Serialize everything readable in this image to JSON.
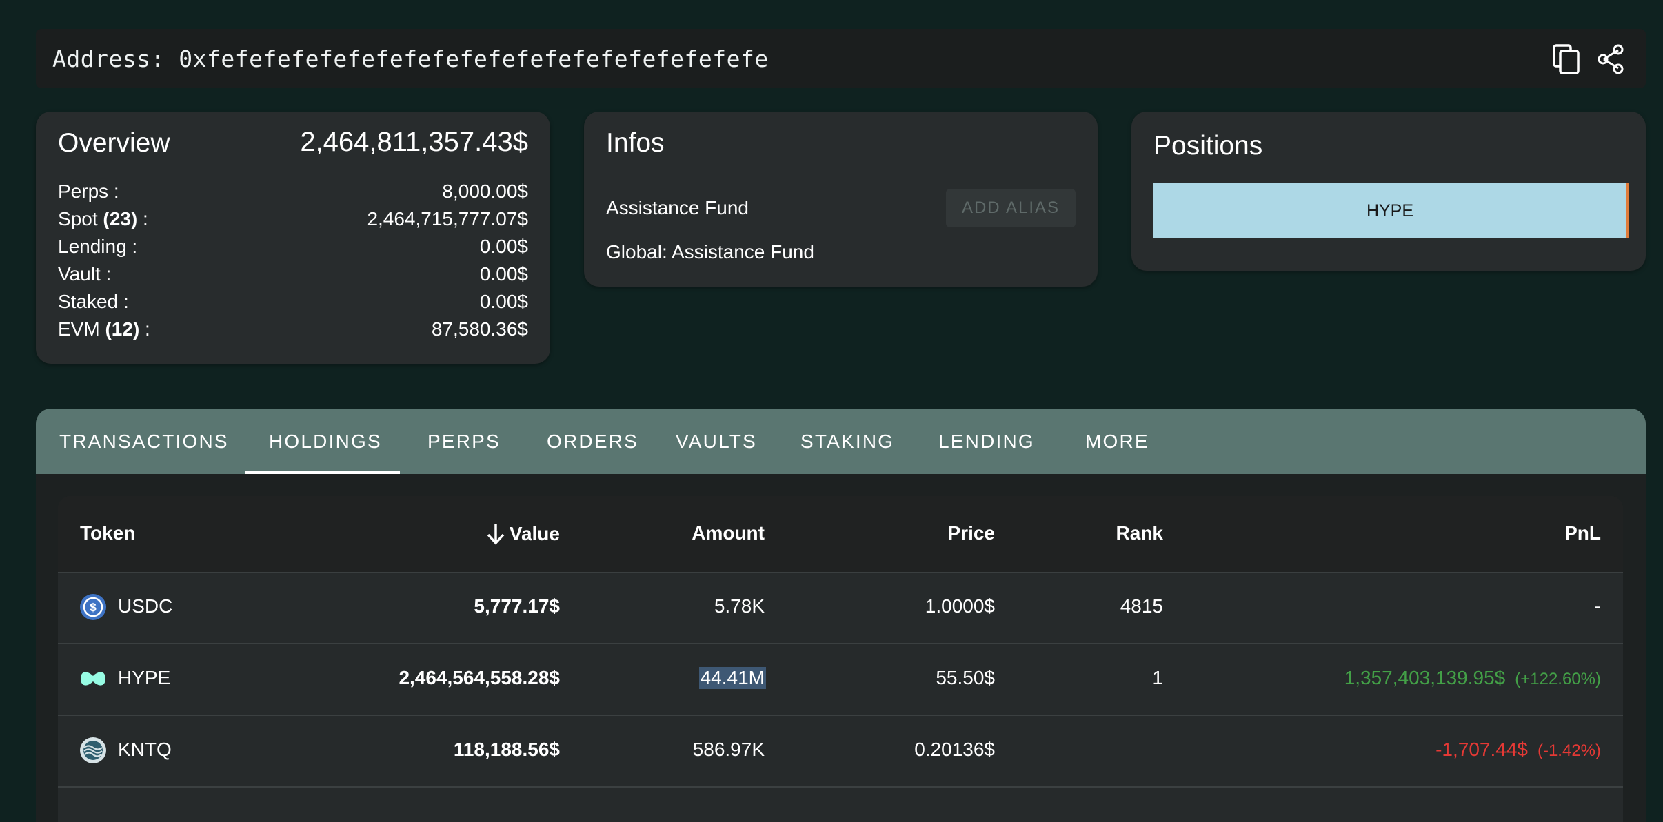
{
  "address": {
    "label": "Address: 0xfefefefefefefefefefefefefefefefefefefefe"
  },
  "overview": {
    "title": "Overview",
    "total": "2,464,811,357.43$",
    "rows": [
      {
        "label": "Perps :",
        "value": "8,000.00$"
      },
      {
        "label_prefix": "Spot ",
        "count": "(23)",
        "label_suffix": " :",
        "value": "2,464,715,777.07$"
      },
      {
        "label": "Lending :",
        "value": "0.00$"
      },
      {
        "label": "Vault :",
        "value": "0.00$"
      },
      {
        "label": "Staked :",
        "value": "0.00$"
      },
      {
        "label_prefix": "EVM ",
        "count": "(12)",
        "label_suffix": " :",
        "value": "87,580.36$"
      }
    ]
  },
  "infos": {
    "title": "Infos",
    "name": "Assistance Fund",
    "global": "Global: Assistance Fund",
    "add_alias_label": "ADD ALIAS"
  },
  "positions": {
    "title": "Positions",
    "bar_label": "HYPE",
    "bar_color": "#add8e6",
    "accent_color": "#e07b3a"
  },
  "tabs": [
    {
      "label": "TRANSACTIONS"
    },
    {
      "label": "HOLDINGS",
      "active": true
    },
    {
      "label": "PERPS"
    },
    {
      "label": "ORDERS"
    },
    {
      "label": "VAULTS"
    },
    {
      "label": "STAKING"
    },
    {
      "label": "LENDING"
    },
    {
      "label": "MORE"
    }
  ],
  "table": {
    "headers": {
      "token": "Token",
      "value": "Value",
      "amount": "Amount",
      "price": "Price",
      "rank": "Rank",
      "pnl": "PnL"
    },
    "sort_icon": "arrow-down-icon",
    "rows": [
      {
        "token": "USDC",
        "icon": "usdc-icon",
        "value": "5,777.17$",
        "amount": "5.78K",
        "price": "1.0000$",
        "rank": "4815",
        "pnl": "-",
        "pnl_pct": ""
      },
      {
        "token": "HYPE",
        "icon": "hype-icon",
        "value": "2,464,564,558.28$",
        "amount": "44.41M",
        "price": "55.50$",
        "rank": "1",
        "pnl": "1,357,403,139.95$",
        "pnl_pct": "(+122.60%)"
      },
      {
        "token": "KNTQ",
        "icon": "kntq-icon",
        "value": "118,188.56$",
        "amount": "586.97K",
        "price": "0.20136$",
        "rank": "",
        "pnl": "-1,707.44$",
        "pnl_pct": "(-1.42%)"
      }
    ]
  },
  "colors": {
    "background": "#0f2220",
    "tabbar": "#5a7671",
    "pnl_positive": "#43a047",
    "pnl_negative": "#e53935"
  }
}
